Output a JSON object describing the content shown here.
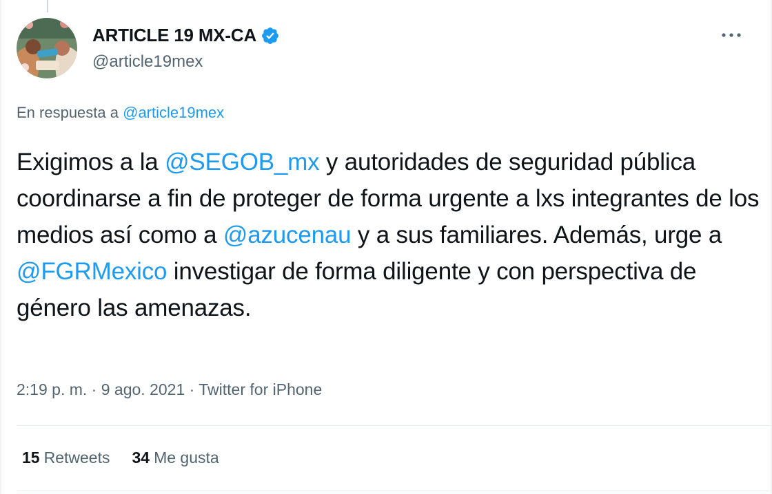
{
  "author": {
    "name": "ARTICLE 19 MX-CA",
    "handle": "@article19mex"
  },
  "reply": {
    "prefix": "En respuesta a",
    "handle": "@article19mex"
  },
  "tweet": {
    "t1": "Exigimos a la ",
    "m1": "@SEGOB_mx",
    "t2": " y autoridades de seguridad pública coordinarse a fin de proteger de forma urgente a lxs integrantes de los medios así como a ",
    "m2": "@azucenau",
    "t3": " y a sus familiares. Además, urge a ",
    "m3": "@FGRMexico",
    "t4": " investigar de forma diligente y con perspectiva de género las amenazas."
  },
  "meta": {
    "time": "2:19 p. m.",
    "sep1": " · ",
    "date": "9 ago. 2021",
    "sep2": " · ",
    "source": "Twitter for iPhone"
  },
  "stats": {
    "retweets_count": "15",
    "retweets_label": "Retweets",
    "likes_count": "34",
    "likes_label": "Me gusta"
  },
  "colors": {
    "link": "#1d9bf0",
    "secondary_text": "#536471",
    "primary_text": "#0f1419",
    "verified": "#1d9bf0"
  },
  "icons": {
    "verified": "verified-badge-icon",
    "more": "more-options-icon"
  }
}
